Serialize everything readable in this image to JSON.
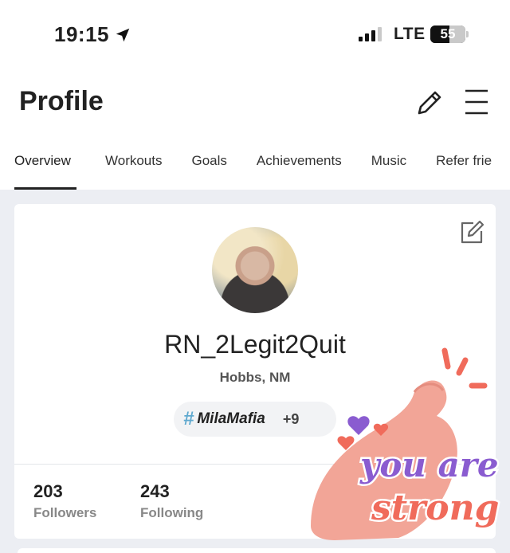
{
  "status_bar": {
    "time": "19:15",
    "network": "LTE",
    "battery_percent": "55",
    "battery_level": 0.55
  },
  "header": {
    "title": "Profile",
    "icons": [
      "pencil-icon",
      "hamburger-menu-icon"
    ]
  },
  "tabs": [
    {
      "label": "Overview",
      "active": true
    },
    {
      "label": "Workouts",
      "active": false
    },
    {
      "label": "Goals",
      "active": false
    },
    {
      "label": "Achievements",
      "active": false
    },
    {
      "label": "Music",
      "active": false
    },
    {
      "label": "Refer frie",
      "active": false
    }
  ],
  "profile": {
    "username": "RN_2Legit2Quit",
    "location": "Hobbs, NM",
    "tag": {
      "hash": "#",
      "name": "MilaMafia",
      "more": "+9"
    },
    "followers": {
      "count": "203",
      "label": "Followers"
    },
    "following": {
      "count": "243",
      "label": "Following"
    }
  },
  "sticker": {
    "line1": "you are",
    "line2": "strong"
  },
  "colors": {
    "background": "#eceef3",
    "card": "#ffffff",
    "tag_hash": "#5fa9cf",
    "sticker_arm": "#f2a597",
    "sticker_text_1": "#8a5cd0",
    "sticker_text_2": "#f06b5b"
  }
}
